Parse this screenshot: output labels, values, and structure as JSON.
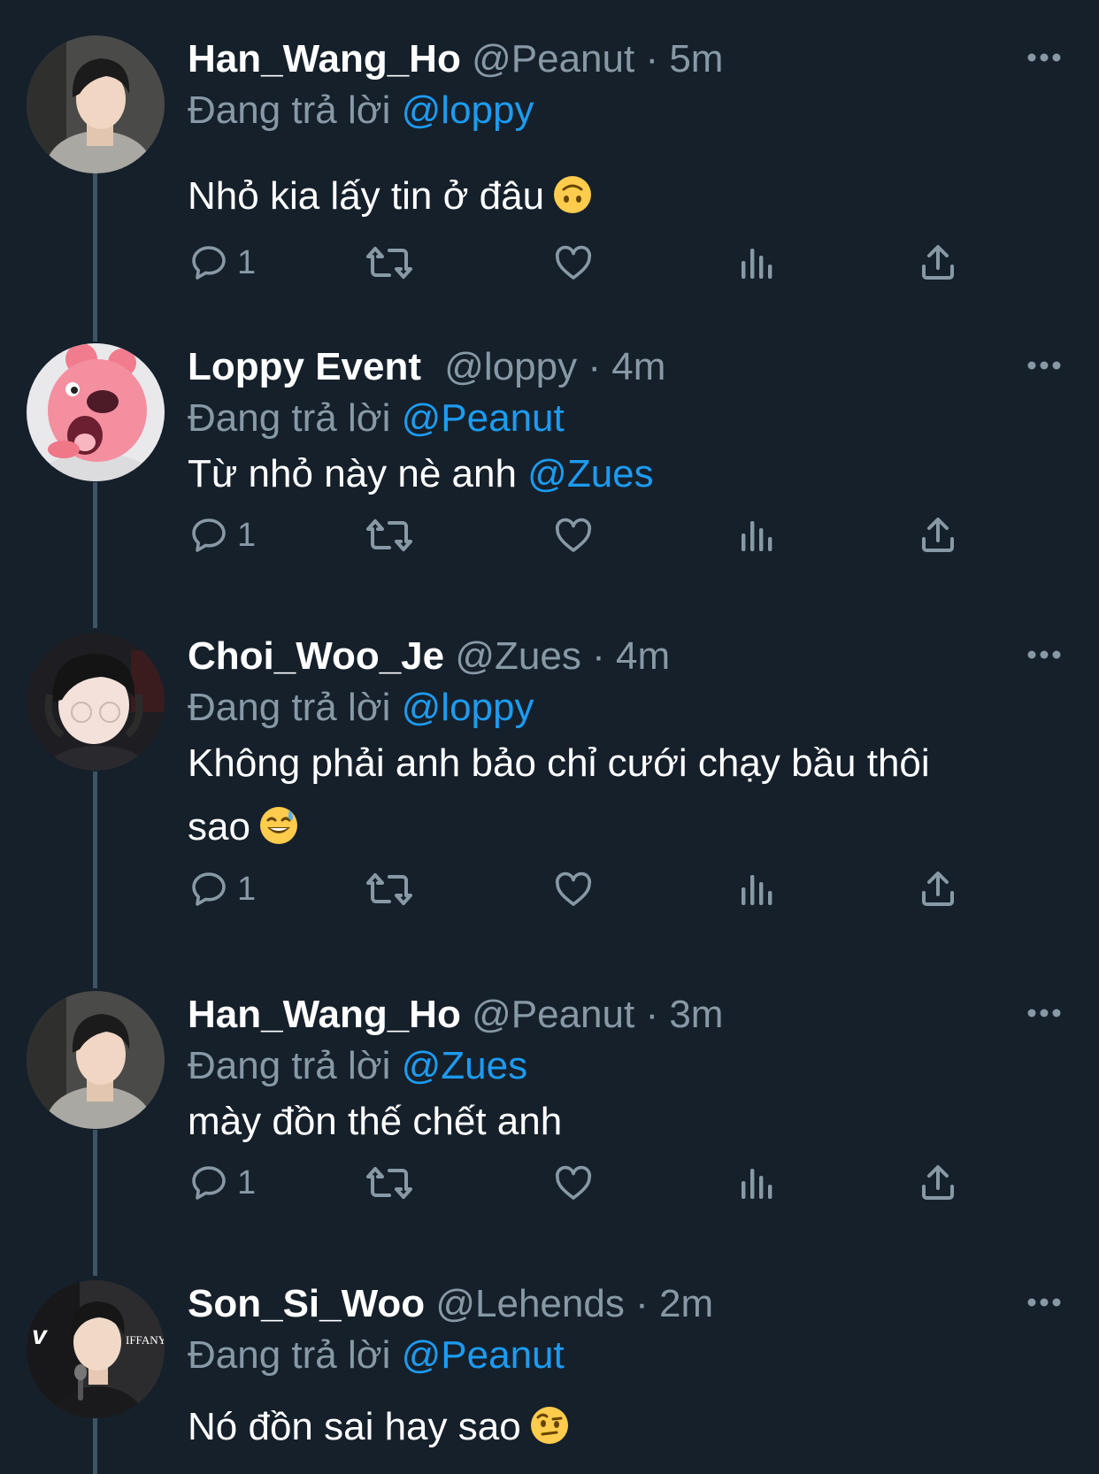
{
  "colors": {
    "background": "#15202b",
    "text_primary": "#ffffff",
    "text_secondary": "#8899a6",
    "mention": "#1d9bf0",
    "thread_line": "#3d5466"
  },
  "icons": {
    "more": "more-horizontal-icon",
    "reply": "reply-bubble-icon",
    "retweet": "retweet-icon",
    "like": "heart-icon",
    "views": "analytics-bars-icon",
    "share": "share-upload-icon"
  },
  "tweets": [
    {
      "name": "Han_Wang_Ho",
      "handle": "@Peanut",
      "separator": "·",
      "time": "5m",
      "replying_prefix": "Đang trả lời",
      "replying_to": "@loppy",
      "text": "Nhỏ kia lấy tin ở đâu",
      "text_mention": "",
      "text_line2": "",
      "emoji": "upside-down-face",
      "reply_count": "1"
    },
    {
      "name": "Loppy Event",
      "handle": "@loppy",
      "separator": "·",
      "time": "4m",
      "replying_prefix": "Đang trả lời",
      "replying_to": "@Peanut",
      "text": "Từ nhỏ này nè anh",
      "text_mention": "@Zues",
      "text_line2": "",
      "emoji": "",
      "reply_count": "1"
    },
    {
      "name": "Choi_Woo_Je",
      "handle": "@Zues",
      "separator": "·",
      "time": "4m",
      "replying_prefix": "Đang trả lời",
      "replying_to": "@loppy",
      "text": "Không phải anh bảo chỉ cưới chạy bầu thôi",
      "text_mention": "",
      "text_line2": "sao",
      "emoji": "grinning-sweat",
      "reply_count": "1"
    },
    {
      "name": "Han_Wang_Ho",
      "handle": "@Peanut",
      "separator": "·",
      "time": "3m",
      "replying_prefix": "Đang trả lời",
      "replying_to": "@Zues",
      "text": "mày đồn thế chết anh",
      "text_mention": "",
      "text_line2": "",
      "emoji": "",
      "reply_count": "1"
    },
    {
      "name": "Son_Si_Woo",
      "handle": "@Lehends",
      "separator": "·",
      "time": "2m",
      "replying_prefix": "Đang trả lời",
      "replying_to": "@Peanut",
      "text": "Nó đồn sai hay sao",
      "text_mention": "",
      "text_line2": "",
      "emoji": "raised-eyebrow",
      "avatar_logo_text": "IFFANY",
      "reply_count": ""
    }
  ]
}
